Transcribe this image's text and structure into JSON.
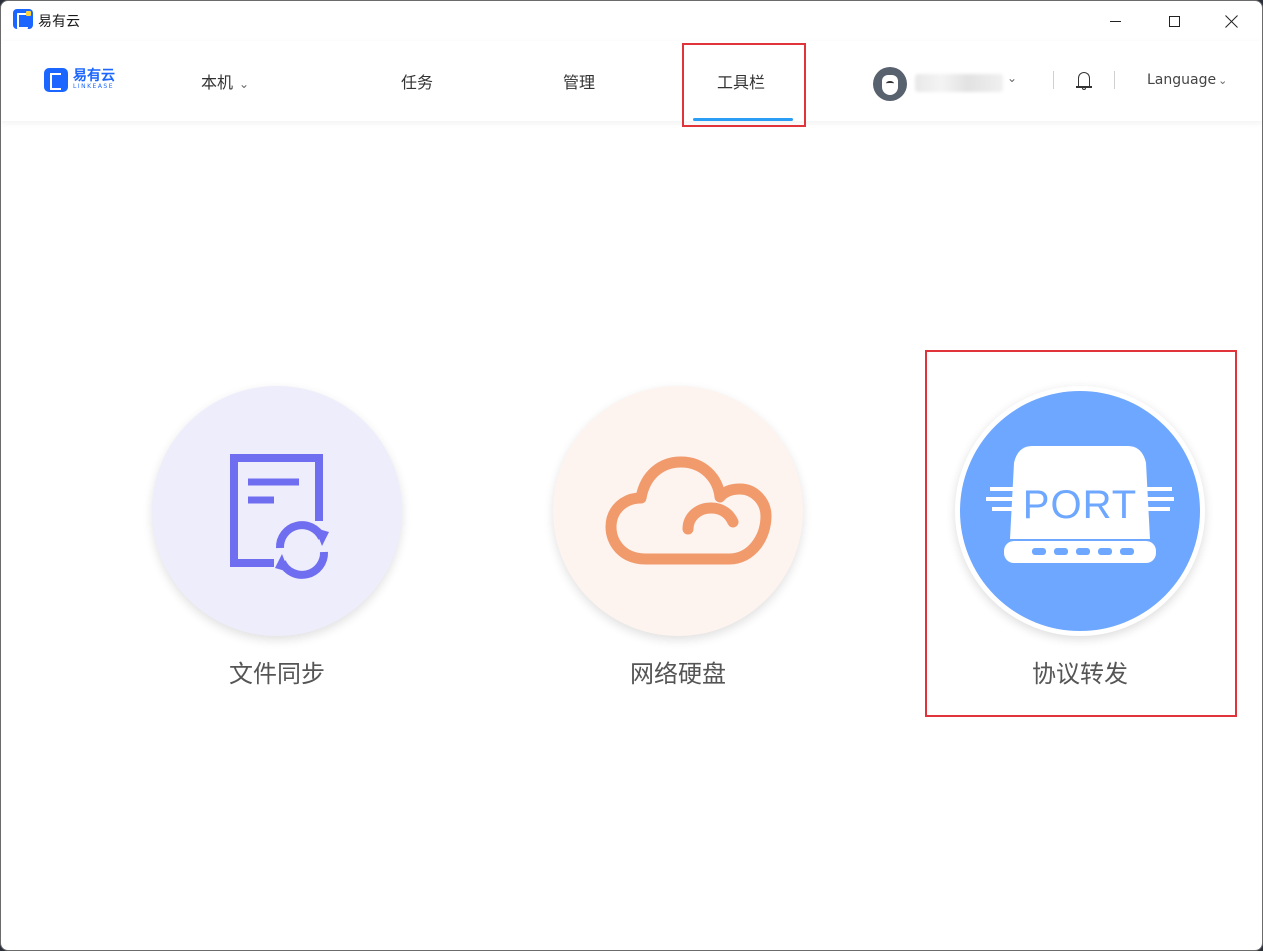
{
  "window": {
    "title": "易有云"
  },
  "brand": {
    "name": "易有云",
    "subtitle": "LINKEASE"
  },
  "nav": {
    "local": "本机",
    "tasks": "任务",
    "manage": "管理",
    "tools": "工具栏",
    "active": "工具栏"
  },
  "header": {
    "language": "Language"
  },
  "tools": [
    {
      "label": "文件同步",
      "icon": "file-sync-icon",
      "color": "#6f6df0"
    },
    {
      "label": "网络硬盘",
      "icon": "cloud-icon",
      "color": "#f19a6b"
    },
    {
      "label": "协议转发",
      "icon": "port-icon",
      "icon_text": "PORT",
      "color": "#6ea7ff"
    }
  ],
  "colors": {
    "accent": "#2a9df4",
    "brand": "#1a66ff",
    "highlight": "#e0343a"
  }
}
